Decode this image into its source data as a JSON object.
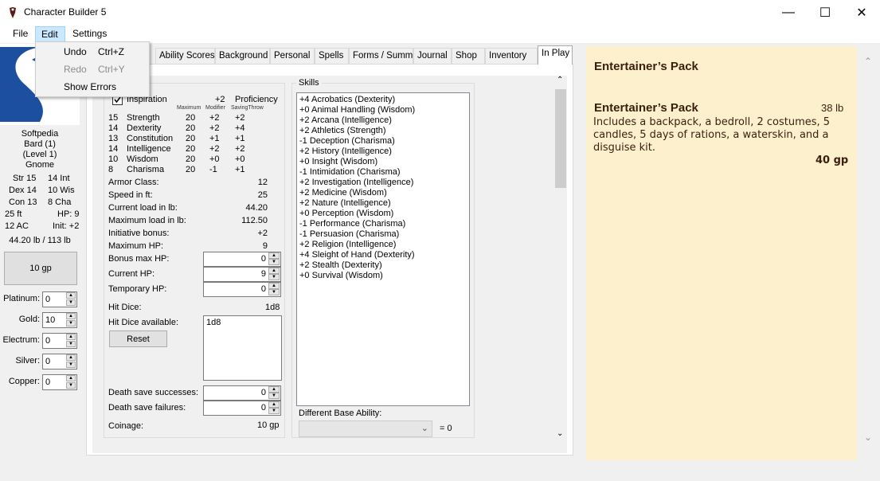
{
  "window": {
    "title": "Character Builder 5",
    "minimize": "—",
    "maximize": "☐",
    "close": "✕"
  },
  "menu": {
    "file": "File",
    "edit": "Edit",
    "settings": "Settings",
    "edit_items": [
      {
        "label": "Undo",
        "shortcut": "Ctrl+Z",
        "enabled": true
      },
      {
        "label": "Redo",
        "shortcut": "Ctrl+Y",
        "enabled": false
      },
      {
        "label": "Show Errors",
        "shortcut": "",
        "enabled": true
      }
    ]
  },
  "summary": {
    "name": "Softpedia",
    "class": "Bard (1)",
    "level": "(Level 1)",
    "race": "Gnome",
    "str": "Str 15",
    "int": "14 Int",
    "dex": "Dex 14",
    "wis": "10 Wis",
    "con": "Con 13",
    "cha": "8 Cha",
    "speed": "25 ft",
    "hp": "HP: 9",
    "ac": "12 AC",
    "init": "Init: +2",
    "load": "44.20 lb / 113 lb",
    "purse": "10 gp"
  },
  "coins": [
    {
      "label": "Platinum:",
      "value": "0"
    },
    {
      "label": "Gold:",
      "value": "10"
    },
    {
      "label": "Electrum:",
      "value": "0"
    },
    {
      "label": "Silver:",
      "value": "0"
    },
    {
      "label": "Copper:",
      "value": "0"
    }
  ],
  "tabs": [
    "Ability Scores",
    "Background",
    "Personal",
    "Spells",
    "Forms / Summons",
    "Journal",
    "Shop",
    "Inventory",
    "In Play"
  ],
  "active_tab": "In Play",
  "stats": {
    "inspiration": "Inspiration",
    "proficiency_val": "+2",
    "proficiency": "Proficiency",
    "headers": {
      "max": "Maximum",
      "mod": "Modifier",
      "save": "SavingThrow"
    },
    "abilities": [
      {
        "score": "15",
        "name": "Strength",
        "max": "20",
        "mod": "+2",
        "save": "+2"
      },
      {
        "score": "14",
        "name": "Dexterity",
        "max": "20",
        "mod": "+2",
        "save": "+4"
      },
      {
        "score": "13",
        "name": "Constitution",
        "max": "20",
        "mod": "+1",
        "save": "+1"
      },
      {
        "score": "14",
        "name": "Intelligence",
        "max": "20",
        "mod": "+2",
        "save": "+2"
      },
      {
        "score": "10",
        "name": "Wisdom",
        "max": "20",
        "mod": "+0",
        "save": "+0"
      },
      {
        "score": "8",
        "name": "Charisma",
        "max": "20",
        "mod": "-1",
        "save": "+1"
      }
    ],
    "derived": [
      {
        "label": "Armor Class:",
        "value": "12"
      },
      {
        "label": "Speed in ft:",
        "value": "25"
      },
      {
        "label": "Current load in lb:",
        "value": "44.20"
      },
      {
        "label": "Maximum load in lb:",
        "value": "112.50"
      },
      {
        "label": "Initiative bonus:",
        "value": "+2"
      },
      {
        "label": "Maximum HP:",
        "value": "9"
      }
    ],
    "hp_inputs": [
      {
        "label": "Bonus max HP:",
        "value": "0"
      },
      {
        "label": "Current HP:",
        "value": "9"
      },
      {
        "label": "Temporary HP:",
        "value": "0"
      }
    ],
    "hit_dice_label": "Hit Dice:",
    "hit_dice_value": "1d8",
    "hit_dice_avail_label": "Hit Dice available:",
    "hit_dice_avail_value": "1d8",
    "reset": "Reset",
    "death_successes_label": "Death save successes:",
    "death_successes": "0",
    "death_failures_label": "Death save failures:",
    "death_failures": "0",
    "coinage_label": "Coinage:",
    "coinage_value": "10 gp"
  },
  "skills": {
    "title": "Skills",
    "items": [
      "+4 Acrobatics (Dexterity)",
      "+0 Animal Handling (Wisdom)",
      "+2 Arcana (Intelligence)",
      "+2 Athletics (Strength)",
      "-1 Deception (Charisma)",
      "+2 History (Intelligence)",
      "+0 Insight (Wisdom)",
      "-1 Intimidation (Charisma)",
      "+2 Investigation (Intelligence)",
      "+2 Medicine (Wisdom)",
      "+2 Nature (Intelligence)",
      "+0 Perception (Wisdom)",
      "-1 Performance (Charisma)",
      "-1 Persuasion (Charisma)",
      "+2 Religion (Intelligence)",
      "+4 Sleight of Hand (Dexterity)",
      "+2 Stealth (Dexterity)",
      "+0 Survival (Wisdom)"
    ],
    "base_label": "Different Base Ability:",
    "base_result": "= 0"
  },
  "detail": {
    "heading": "Entertainer’s Pack",
    "item_name": "Entertainer’s Pack",
    "weight": "38 lb",
    "description": "Includes a backpack, a bedroll, 2 costumes, 5 candles, 5 days of rations, a waterskin, and a disguise kit.",
    "price": "40 gp"
  },
  "colors": {
    "detail_bg": "#fdf0cc",
    "detail_text": "#3b1f0e",
    "menu_highlight": "#cce8ff"
  }
}
